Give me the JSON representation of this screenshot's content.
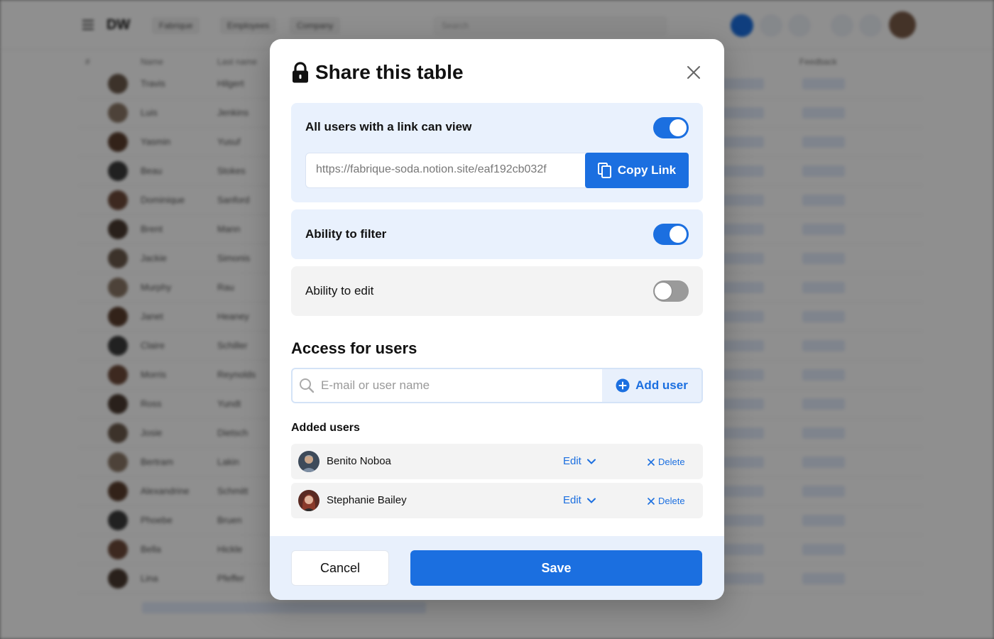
{
  "background": {
    "logo": "DW",
    "nav_pills": [
      "Fabrique",
      "Employees",
      "Company"
    ],
    "search_placeholder": "Search",
    "column_headers": [
      "#",
      "Name",
      "Last name",
      "Feedback"
    ],
    "rows": [
      {
        "first": "Travis",
        "last": "Hilgert"
      },
      {
        "first": "Luis",
        "last": "Jenkins"
      },
      {
        "first": "Yasmin",
        "last": "Yusuf"
      },
      {
        "first": "Beau",
        "last": "Stokes"
      },
      {
        "first": "Dominique",
        "last": "Sanford"
      },
      {
        "first": "Brent",
        "last": "Mann"
      },
      {
        "first": "Jackie",
        "last": "Simonis"
      },
      {
        "first": "Murphy",
        "last": "Rau"
      },
      {
        "first": "Janet",
        "last": "Heaney"
      },
      {
        "first": "Claire",
        "last": "Schiller"
      },
      {
        "first": "Morris",
        "last": "Reynolds"
      },
      {
        "first": "Ross",
        "last": "Yundt"
      },
      {
        "first": "Josie",
        "last": "Dietsch"
      },
      {
        "first": "Bertram",
        "last": "Lakin"
      },
      {
        "first": "Alexandrine",
        "last": "Schmitt"
      },
      {
        "first": "Phoebe",
        "last": "Bruen"
      },
      {
        "first": "Bella",
        "last": "Hickle"
      },
      {
        "first": "Lina",
        "last": "Pfeffer"
      }
    ]
  },
  "modal": {
    "title": "Share this table",
    "link_panel": {
      "label": "All users with a link can view",
      "toggle_on": true,
      "url": "https://fabrique-soda.notion.site/eaf192cb032f",
      "copy_label": "Copy Link"
    },
    "filter_panel": {
      "label": "Ability to filter",
      "toggle_on": true
    },
    "edit_panel": {
      "label": "Ability to edit",
      "toggle_on": false
    },
    "access_title": "Access for users",
    "user_input_placeholder": "E-mail or user name",
    "add_user_label": "Add user",
    "added_users_title": "Added users",
    "users": [
      {
        "name": "Benito Noboa",
        "edit_label": "Edit",
        "delete_label": "Delete"
      },
      {
        "name": "Stephanie Bailey",
        "edit_label": "Edit",
        "delete_label": "Delete"
      }
    ],
    "cancel_label": "Cancel",
    "save_label": "Save"
  },
  "colors": {
    "accent": "#1b6fe0",
    "panel_blue": "#e9f1fd",
    "panel_gray": "#f3f3f3",
    "toggle_off": "#9a9a9a"
  },
  "icons": [
    "menu-icon",
    "lock-icon",
    "close-icon",
    "copy-icon",
    "search-icon",
    "plus-circle-icon",
    "chevron-down-icon",
    "x-icon"
  ]
}
